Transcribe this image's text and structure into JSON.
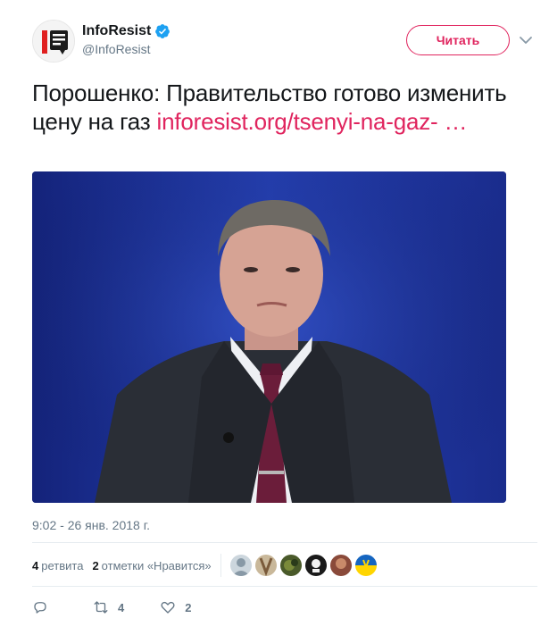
{
  "author": {
    "display_name": "InfoResist",
    "handle": "@InfoResist",
    "verified": true
  },
  "follow_button": {
    "label": "Читать"
  },
  "tweet": {
    "text": "Порошенко: Правительство готово изменить цену на газ ",
    "link_text": "inforesist.org/tsenyi-na-gaz- …"
  },
  "media": {
    "description_icon": "photo-of-man-in-suit"
  },
  "timestamp": "9:02 - 26 янв. 2018 г.",
  "stats": {
    "retweets_count": "4",
    "retweets_label": "ретвита",
    "likes_count": "2",
    "likes_label": "отметки «Нравится»"
  },
  "actions": {
    "reply_count": "",
    "retweet_count": "4",
    "like_count": "2"
  },
  "colors": {
    "accent": "#e0245e",
    "verified": "#1da1f2",
    "muted": "#657786",
    "text": "#14171a"
  }
}
